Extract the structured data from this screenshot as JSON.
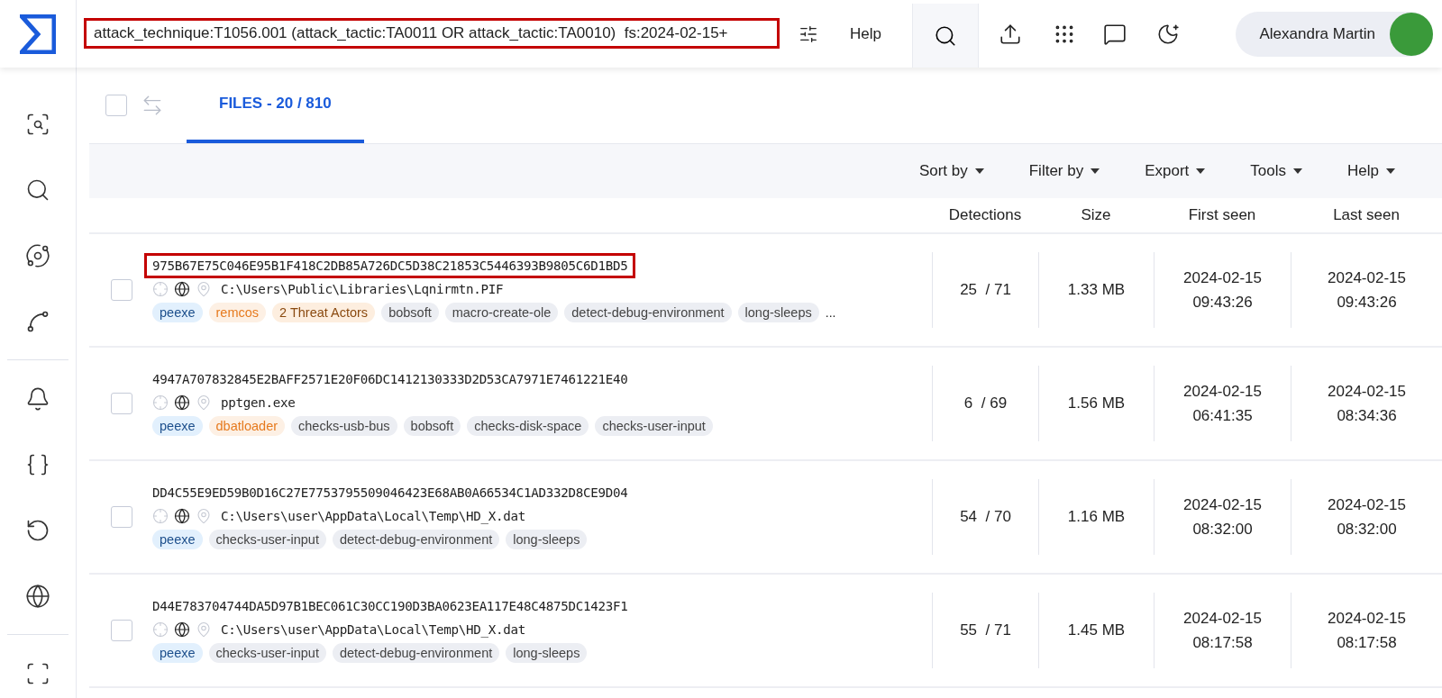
{
  "header": {
    "search": {
      "value": "attack_technique:T1056.001 (attack_tactic:TA0011 OR attack_tactic:TA0010)  fs:2024-02-15+",
      "highlighted": true
    },
    "help": "Help",
    "user": "Alexandra Martin"
  },
  "select_all": {
    "checked": false
  },
  "tabs": [
    {
      "label": "FILES - 20 / 810",
      "selected": true
    }
  ],
  "toolbar": [
    "Sort by",
    "Filter by",
    "Export",
    "Tools",
    "Help"
  ],
  "table": {
    "columns": [
      "Detections",
      "Size",
      "First seen",
      "Last seen"
    ],
    "rows": [
      {
        "hash": "975B67E75C046E95B1F418C2DB85A726DC5D38C21853C5446393B9805C6D1BD5",
        "highlighted": true,
        "checked": false,
        "path": "C:\\Users\\Public\\Libraries\\Lqnirmtn.PIF",
        "tags": [
          {
            "label": "peexe",
            "kind": "type"
          },
          {
            "label": "remcos",
            "kind": "family"
          },
          {
            "label": "2 Threat Actors",
            "kind": "actor"
          },
          {
            "label": "bobsoft",
            "kind": "tag"
          },
          {
            "label": "macro-create-ole",
            "kind": "tag"
          },
          {
            "label": "detect-debug-environment",
            "kind": "tag"
          },
          {
            "label": "long-sleeps",
            "kind": "tag"
          }
        ],
        "more": "...",
        "detections": "25  / 71",
        "size": "1.33 MB",
        "first_seen": [
          "2024-02-15",
          "09:43:26"
        ],
        "last_seen": [
          "2024-02-15",
          "09:43:26"
        ]
      },
      {
        "hash": "4947A707832845E2BAFF2571E20F06DC1412130333D2D53CA7971E7461221E40",
        "highlighted": false,
        "checked": false,
        "path": "pptgen.exe",
        "tags": [
          {
            "label": "peexe",
            "kind": "type"
          },
          {
            "label": "dbatloader",
            "kind": "family"
          },
          {
            "label": "checks-usb-bus",
            "kind": "tag"
          },
          {
            "label": "bobsoft",
            "kind": "tag"
          },
          {
            "label": "checks-disk-space",
            "kind": "tag"
          },
          {
            "label": "checks-user-input",
            "kind": "tag"
          }
        ],
        "detections": "6  / 69",
        "size": "1.56 MB",
        "first_seen": [
          "2024-02-15",
          "06:41:35"
        ],
        "last_seen": [
          "2024-02-15",
          "08:34:36"
        ]
      },
      {
        "hash": "DD4C55E9ED59B0D16C27E7753795509046423E68AB0A66534C1AD332D8CE9D04",
        "highlighted": false,
        "checked": false,
        "path": "C:\\Users\\user\\AppData\\Local\\Temp\\HD_X.dat",
        "tags": [
          {
            "label": "peexe",
            "kind": "type"
          },
          {
            "label": "checks-user-input",
            "kind": "tag"
          },
          {
            "label": "detect-debug-environment",
            "kind": "tag"
          },
          {
            "label": "long-sleeps",
            "kind": "tag"
          }
        ],
        "detections": "54  / 70",
        "size": "1.16 MB",
        "first_seen": [
          "2024-02-15",
          "08:32:00"
        ],
        "last_seen": [
          "2024-02-15",
          "08:32:00"
        ]
      },
      {
        "hash": "D44E783704744DA5D97B1BEC061C30CC190D3BA0623EA117E48C4875DC1423F1",
        "highlighted": false,
        "checked": false,
        "path": "C:\\Users\\user\\AppData\\Local\\Temp\\HD_X.dat",
        "tags": [
          {
            "label": "peexe",
            "kind": "type"
          },
          {
            "label": "checks-user-input",
            "kind": "tag"
          },
          {
            "label": "detect-debug-environment",
            "kind": "tag"
          },
          {
            "label": "long-sleeps",
            "kind": "tag"
          }
        ],
        "detections": "55  / 71",
        "size": "1.45 MB",
        "first_seen": [
          "2024-02-15",
          "08:17:58"
        ],
        "last_seen": [
          "2024-02-15",
          "08:17:58"
        ]
      }
    ]
  }
}
